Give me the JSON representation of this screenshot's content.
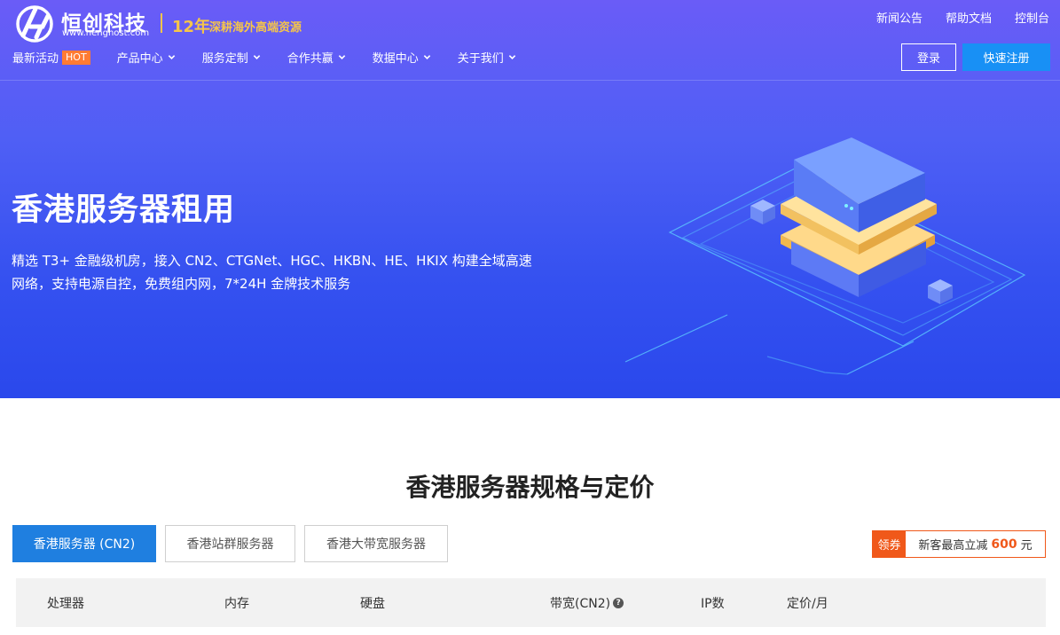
{
  "logo": {
    "name": "恒创科技",
    "url": "www.henghost.com",
    "years": "12年",
    "slogan": "深耕海外高端资源"
  },
  "top_links": [
    "新闻公告",
    "帮助文档",
    "控制台"
  ],
  "nav": {
    "items": [
      {
        "label": "最新活动",
        "badge": "HOT"
      },
      {
        "label": "产品中心"
      },
      {
        "label": "服务定制"
      },
      {
        "label": "合作共赢"
      },
      {
        "label": "数据中心"
      },
      {
        "label": "关于我们"
      }
    ],
    "login_label": "登录",
    "register_label": "快速注册"
  },
  "hero": {
    "title": "香港服务器租用",
    "description": "精选 T3+ 金融级机房，接入 CN2、CTGNet、HGC、HKBN、HE、HKIX 构建全域高速网络，支持电源自控，免费组内网，7*24H 金牌技术服务"
  },
  "section": {
    "title": "香港服务器规格与定价",
    "tabs": [
      {
        "label": "香港服务器 (CN2)",
        "active": true
      },
      {
        "label": "香港站群服务器",
        "active": false
      },
      {
        "label": "香港大带宽服务器",
        "active": false
      }
    ],
    "coupon": {
      "tag": "领券",
      "prefix": "新客最高立减",
      "amount": "600",
      "unit": "元"
    }
  },
  "table": {
    "headers": [
      "处理器",
      "内存",
      "硬盘",
      "带宽(CN2)",
      "IP数",
      "定价/月"
    ]
  },
  "colors": {
    "accent": "#1890f5",
    "tab_active": "#1f7fe0",
    "coupon": "#f0581a",
    "hot": "#ff7b33",
    "gold": "#f5c54a"
  }
}
